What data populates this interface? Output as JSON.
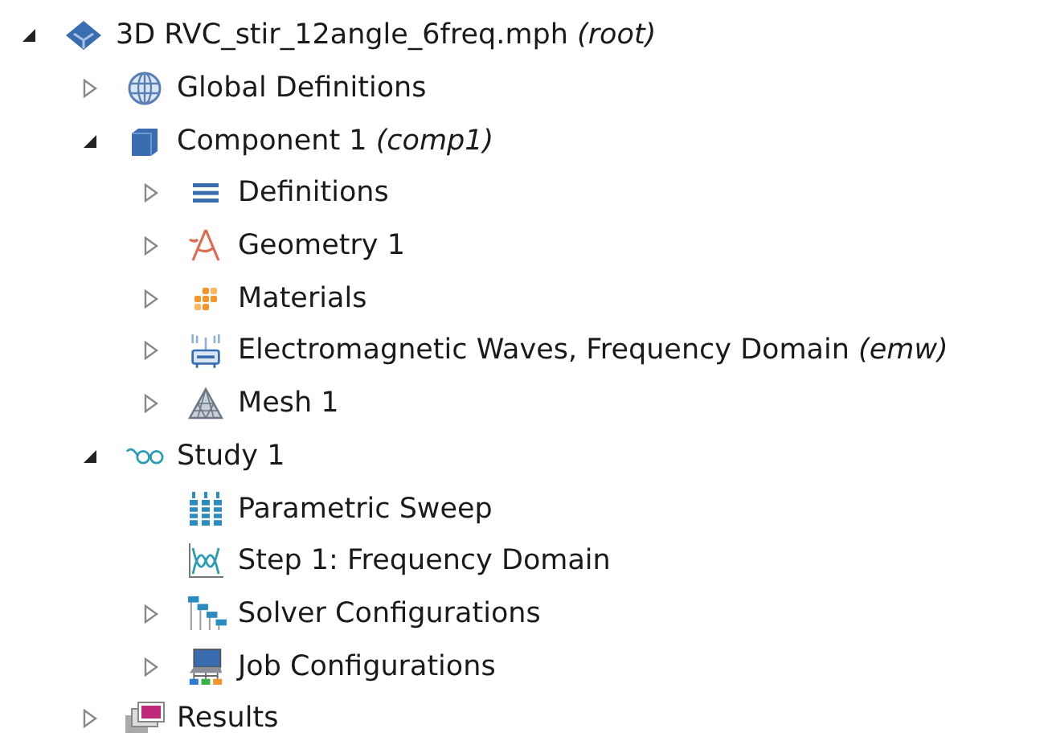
{
  "tree": [
    {
      "label": "3D RVC_stir_12angle_6freq.mph *(root)*",
      "kind": "model",
      "expanded": true,
      "children": [
        {
          "label": "Global Definitions",
          "kind": "globe",
          "expanded": false
        },
        {
          "label": "Component 1 *(comp1)*",
          "kind": "component",
          "expanded": true,
          "children": [
            {
              "label": "Definitions",
              "kind": "definitions",
              "expanded": false
            },
            {
              "label": "Geometry 1",
              "kind": "geometry",
              "expanded": false
            },
            {
              "label": "Materials",
              "kind": "materials",
              "expanded": false
            },
            {
              "label": "Electromagnetic Waves, Frequency Domain *(emw)*",
              "kind": "physics",
              "expanded": false
            },
            {
              "label": "Mesh 1",
              "kind": "mesh",
              "expanded": false
            }
          ]
        },
        {
          "label": "Study 1",
          "kind": "study",
          "expanded": true,
          "children": [
            {
              "label": "Parametric Sweep",
              "kind": "sweep"
            },
            {
              "label": "Step 1: Frequency Domain",
              "kind": "step"
            },
            {
              "label": "Solver Configurations",
              "kind": "solver",
              "expanded": false
            },
            {
              "label": "Job Configurations",
              "kind": "job",
              "expanded": false
            }
          ]
        },
        {
          "label": "Results",
          "kind": "results",
          "expanded": false
        }
      ]
    }
  ]
}
